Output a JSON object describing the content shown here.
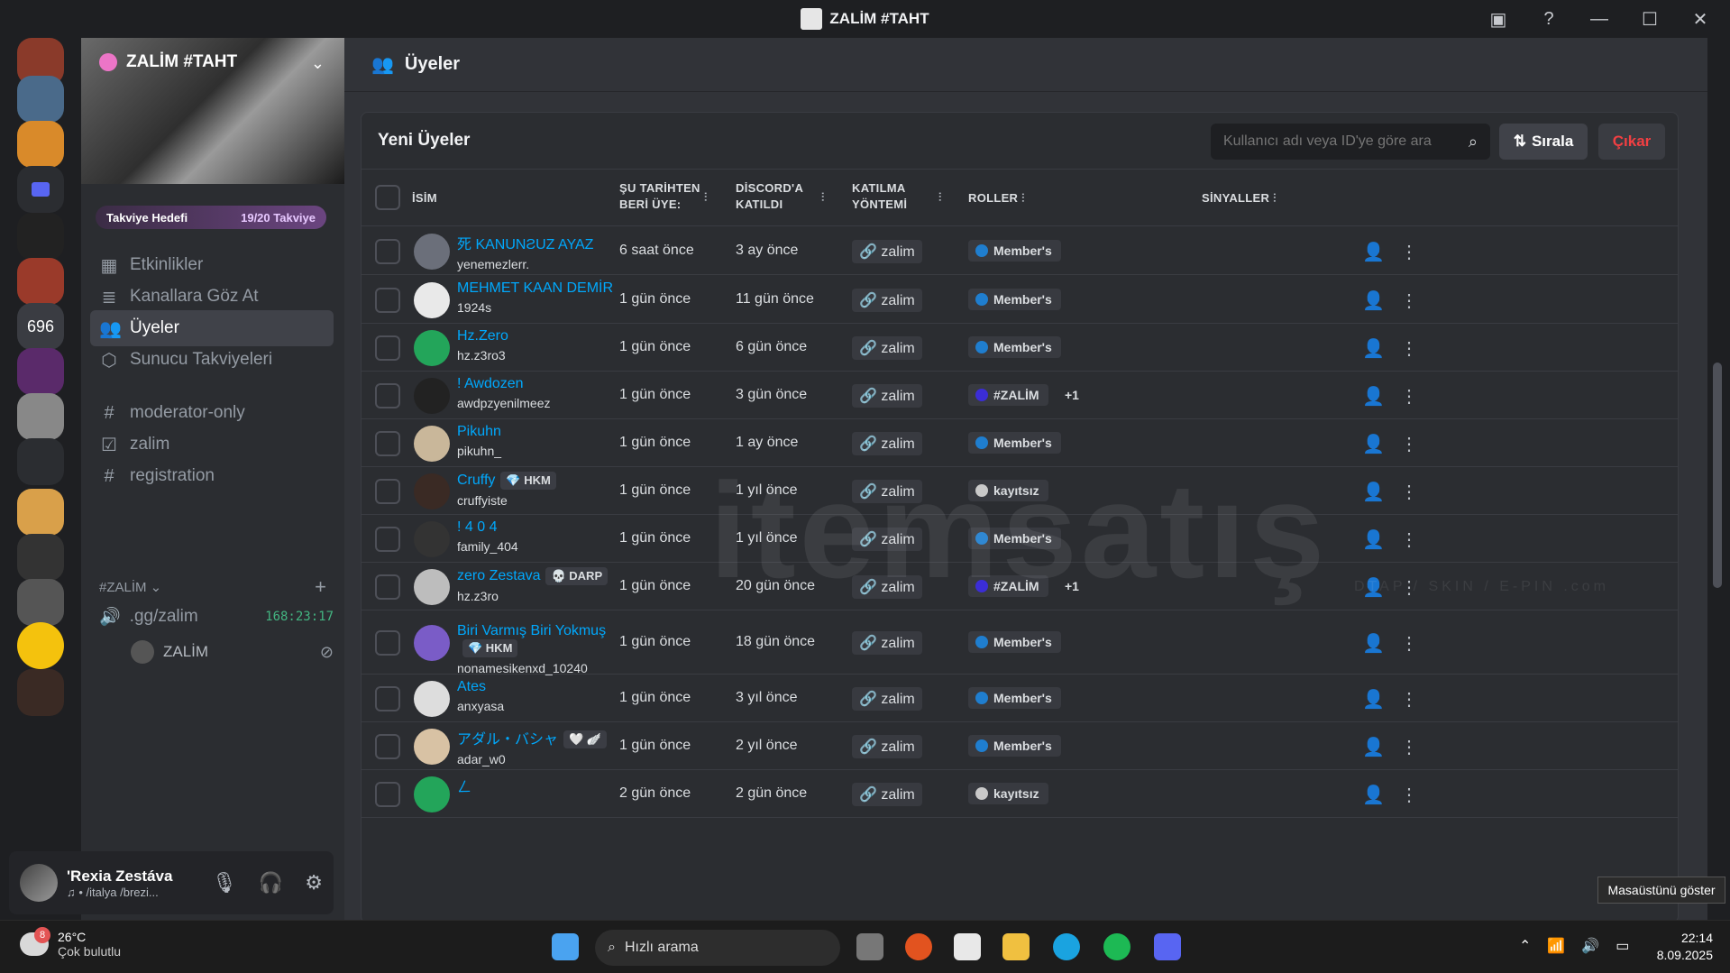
{
  "window": {
    "title": "ZALİM #TAHT"
  },
  "server": {
    "name": "ZALİM #TAHT",
    "boost": {
      "label": "Takviye Hedefi",
      "count": "19/20 Takviye"
    },
    "nav": [
      {
        "label": "Etkinlikler",
        "icon": "calendar-icon"
      },
      {
        "label": "Kanallara Göz At",
        "icon": "browse-channels-icon"
      },
      {
        "label": "Üyeler",
        "icon": "members-icon"
      },
      {
        "label": "Sunucu Takviyeleri",
        "icon": "boost-icon"
      }
    ],
    "channels": [
      {
        "label": "moderator-only",
        "icon": "hash-icon"
      },
      {
        "label": "zalim",
        "icon": "checkbox-channel-icon"
      },
      {
        "label": "registration",
        "icon": "hash-icon"
      }
    ],
    "category": "#ZALİM",
    "voice": {
      "label": ".gg/zalim",
      "timer": "168:23:17",
      "user": "ZALİM"
    },
    "guild_badge": "696"
  },
  "user": {
    "name": "'Rexia Zestáva",
    "status": "♫ • /italya /brezi..."
  },
  "main": {
    "header": "Üyeler",
    "panel_title": "Yeni Üyeler",
    "search_placeholder": "Kullanıcı adı veya ID'ye göre ara",
    "sort_label": "Sırala",
    "kick_label": "Çıkar",
    "columns": {
      "name": "İSİM",
      "member_since": "ŞU TARİHTEN BERİ ÜYE:",
      "joined_discord": "DİSCORD'A KATILDI",
      "join_method": "KATILMA YÖNTEMİ",
      "roles": "ROLLER",
      "signals": "SİNYALLER"
    },
    "rows": [
      {
        "display": "死 KANUNƧUZ AYAZ",
        "user": "yenemezlerr.",
        "since": "6 saat önce",
        "discord": "3 ay önce",
        "method": "zalim",
        "role": "Member's",
        "role_color": "#1f7ecf",
        "extra": "",
        "tag": "",
        "avatar": "#6b6f7a"
      },
      {
        "display": "MEHMET KAAN DEMİR",
        "user": "1924s",
        "since": "1 gün önce",
        "discord": "11 gün önce",
        "method": "zalim",
        "role": "Member's",
        "role_color": "#1f7ecf",
        "extra": "",
        "tag": "",
        "avatar": "#e9e9e9"
      },
      {
        "display": "Hz.Zero",
        "user": "hz.z3ro3",
        "since": "1 gün önce",
        "discord": "6 gün önce",
        "method": "zalim",
        "role": "Member's",
        "role_color": "#1f7ecf",
        "extra": "",
        "tag": "",
        "avatar": "#23a55a"
      },
      {
        "display": "! Awdozen",
        "user": "awdpzyenilmeez",
        "since": "1 gün önce",
        "discord": "3 gün önce",
        "method": "zalim",
        "role": "#ZALİM",
        "role_color": "#3b2dd6",
        "extra": "+1",
        "tag": "",
        "avatar": "#222222"
      },
      {
        "display": "Pikuhn",
        "user": "pikuhn_",
        "since": "1 gün önce",
        "discord": "1 ay önce",
        "method": "zalim",
        "role": "Member's",
        "role_color": "#1f7ecf",
        "extra": "",
        "tag": "",
        "avatar": "#c9b79a"
      },
      {
        "display": "Cruffy",
        "user": "cruffyiste",
        "since": "1 gün önce",
        "discord": "1 yıl önce",
        "method": "zalim",
        "role": "kayıtsız",
        "role_color": "#c9c9c9",
        "extra": "",
        "tag": "💎 HKM",
        "avatar": "#3a2a24"
      },
      {
        "display": "! 4 0 4",
        "user": "family_404",
        "since": "1 gün önce",
        "discord": "1 yıl önce",
        "method": "zalim",
        "role": "Member's",
        "role_color": "#1f7ecf",
        "extra": "",
        "tag": "",
        "avatar": "#333333"
      },
      {
        "display": "zero Zestava",
        "user": "hz.z3ro",
        "since": "1 gün önce",
        "discord": "20 gün önce",
        "method": "zalim",
        "role": "#ZALİM",
        "role_color": "#3b2dd6",
        "extra": "+1",
        "tag": "💀 DARP",
        "avatar": "#bdbdbd"
      },
      {
        "display": "Biri Varmış Biri Yokmuş",
        "user": "nonamesikenxd_10240",
        "since": "1 gün önce",
        "discord": "18 gün önce",
        "method": "zalim",
        "role": "Member's",
        "role_color": "#1f7ecf",
        "extra": "",
        "tag": "💎 HKM",
        "avatar": "#7a5cc7"
      },
      {
        "display": "Ates",
        "user": "anxyasa",
        "since": "1 gün önce",
        "discord": "3 yıl önce",
        "method": "zalim",
        "role": "Member's",
        "role_color": "#1f7ecf",
        "extra": "",
        "tag": "",
        "avatar": "#dddddd"
      },
      {
        "display": "アダル・バシャ",
        "user": "adar_w0",
        "since": "1 gün önce",
        "discord": "2 yıl önce",
        "method": "zalim",
        "role": "Member's",
        "role_color": "#1f7ecf",
        "extra": "",
        "tag": "🤍 🪽",
        "avatar": "#d8c2a4"
      },
      {
        "display": "ㄥ",
        "user": "",
        "since": "2 gün önce",
        "discord": "2 gün önce",
        "method": "zalim",
        "role": "kayıtsız",
        "role_color": "#c9c9c9",
        "extra": "",
        "tag": "",
        "avatar": "#23a55a"
      }
    ]
  },
  "tooltip": "Masaüstünü göster",
  "taskbar": {
    "temp": "26°C",
    "weather": "Çok bulutlu",
    "weather_badge": "8",
    "search": "Hızlı arama",
    "time": "22:14",
    "date": "8.09.2025"
  },
  "watermark": {
    "main": "itemsatış",
    "sub": "DTAP / SKIN / E-PIN .com"
  }
}
